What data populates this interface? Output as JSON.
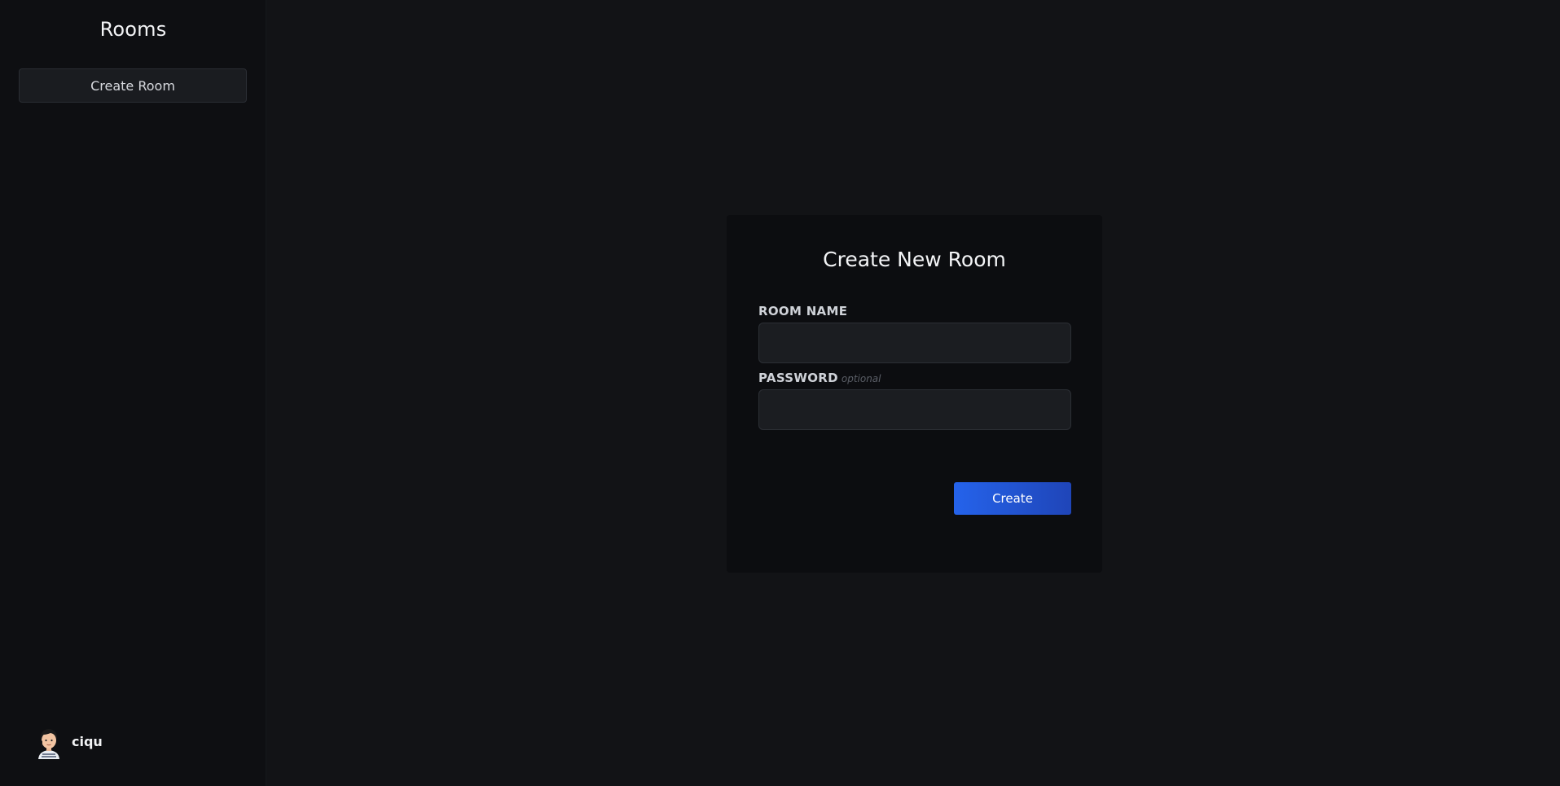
{
  "sidebar": {
    "title": "Rooms",
    "create_room_label": "Create Room",
    "user": {
      "name": "ciqu",
      "avatar_icon": "cartoon-avatar-icon"
    }
  },
  "form": {
    "title": "Create New Room",
    "room_name": {
      "label": "ROOM NAME",
      "value": "",
      "placeholder": ""
    },
    "password": {
      "label": "PASSWORD",
      "hint": "optional",
      "value": "",
      "placeholder": ""
    },
    "submit_label": "Create"
  },
  "colors": {
    "background": "#121316",
    "sidebar": "#0e0f12",
    "card": "#0c0d10",
    "accent": "#2563eb"
  }
}
